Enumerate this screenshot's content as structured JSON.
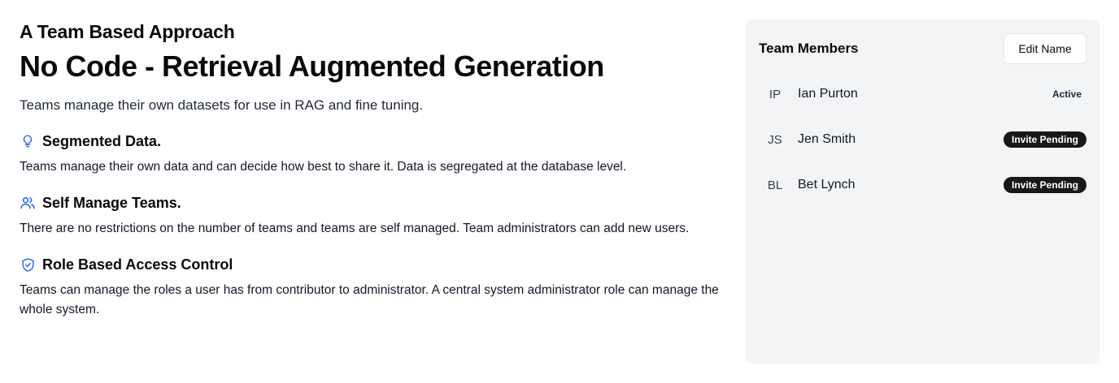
{
  "hero": {
    "eyebrow": "A Team Based Approach",
    "title": "No Code - Retrieval Augmented Generation",
    "lead": "Teams manage their own datasets for use in RAG and fine tuning."
  },
  "features": [
    {
      "icon": "lightbulb-icon",
      "title": "Segmented Data.",
      "description": "Teams manage their own data and can decide how best to share it. Data is segregated at the database level."
    },
    {
      "icon": "users-icon",
      "title": "Self Manage Teams.",
      "description": "There are no restrictions on the number of teams and teams are self managed. Team administrators can add new users."
    },
    {
      "icon": "shield-check-icon",
      "title": "Role Based Access Control",
      "description": "Teams can manage the roles a user has from contributor to administrator. A central system administrator role can manage the whole system."
    }
  ],
  "team_panel": {
    "title": "Team Members",
    "edit_button": "Edit Name",
    "members": [
      {
        "initials": "IP",
        "name": "Ian Purton",
        "status": "Active"
      },
      {
        "initials": "JS",
        "name": "Jen Smith",
        "status": "Invite Pending"
      },
      {
        "initials": "BL",
        "name": "Bet Lynch",
        "status": "Invite Pending"
      }
    ]
  },
  "colors": {
    "accent": "#2563eb",
    "panel_bg": "#f3f4f6",
    "badge_dark": "#18181b"
  }
}
